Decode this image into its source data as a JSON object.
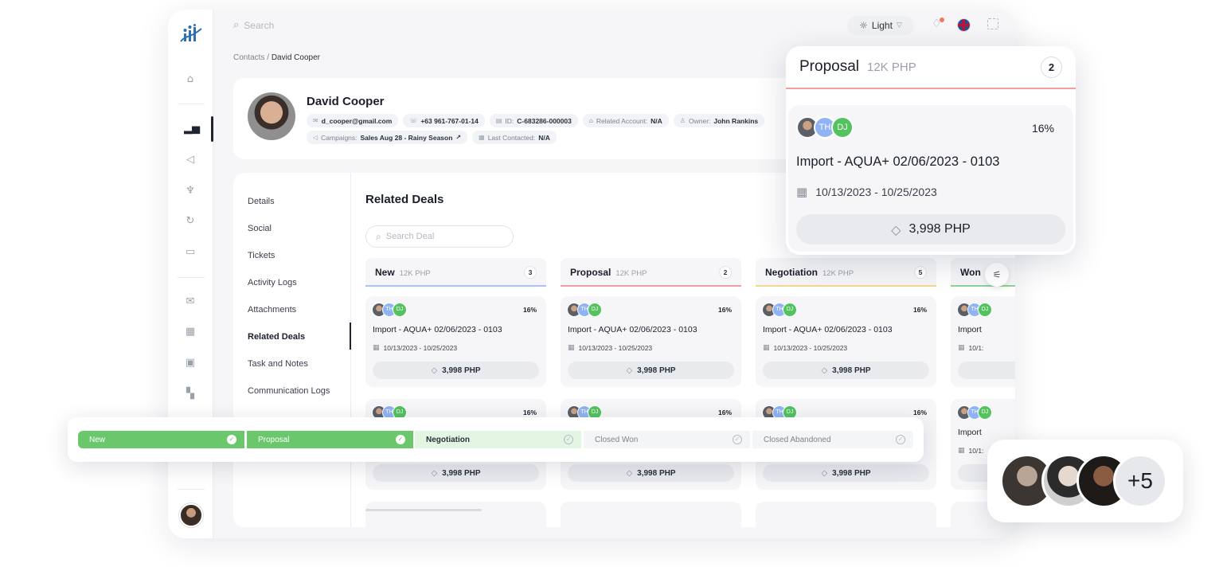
{
  "topbar": {
    "search_placeholder": "Search",
    "theme_label": "Light"
  },
  "breadcrumb": {
    "parent": "Contacts",
    "separator": "/",
    "current": "David Cooper"
  },
  "contact": {
    "name": "David Cooper",
    "email": "d_cooper@gmail.com",
    "phone": "+63 961-767-01-14",
    "id_label": "ID:",
    "id_value": "C-683286-000003",
    "related_account_label": "Related Account:",
    "related_account_value": "N/A",
    "owner_label": "Owner:",
    "owner_value": "John Rankins",
    "campaigns_label": "Campaigns:",
    "campaigns_value": "Sales Aug 28 - Rainy Season",
    "last_contacted_label": "Last Contacted:",
    "last_contacted_value": "N/A"
  },
  "tabs": [
    "Details",
    "Social",
    "Tickets",
    "Activity Logs",
    "Attachments",
    "Related Deals",
    "Task and Notes",
    "Communication Logs"
  ],
  "related_deals": {
    "title": "Related Deals",
    "search_placeholder": "Search Deal",
    "columns": [
      {
        "name": "New",
        "amount": "12K PHP",
        "count": "3",
        "color": "#a9c4ee"
      },
      {
        "name": "Proposal",
        "amount": "12K PHP",
        "count": "2",
        "color": "#f0a0a0"
      },
      {
        "name": "Negotiation",
        "amount": "12K PHP",
        "count": "5",
        "color": "#f2d88a"
      },
      {
        "name": "Won",
        "amount": "",
        "count": "",
        "color": "#8fd39a"
      }
    ],
    "deal": {
      "avatar_th": "TH",
      "avatar_dj": "DJ",
      "percent": "16%",
      "title": "Import - AQUA+ 02/06/2023 - 0103",
      "dates": "10/13/2023 - 10/25/2023",
      "price": "3,998 PHP"
    },
    "cropped": {
      "title": "Import",
      "dates": "10/1:"
    }
  },
  "stages": [
    {
      "label": "New",
      "state": "done"
    },
    {
      "label": "Proposal",
      "state": "done"
    },
    {
      "label": "Negotiation",
      "state": "current"
    },
    {
      "label": "Closed Won",
      "state": "todo"
    },
    {
      "label": "Closed Abandoned",
      "state": "todo"
    }
  ],
  "float_card": {
    "name": "Proposal",
    "amount": "12K PHP",
    "count": "2",
    "avatar_th": "TH",
    "avatar_dj": "DJ",
    "percent": "16%",
    "title": "Import - AQUA+ 02/06/2023 - 0103",
    "dates": "10/13/2023 - 10/25/2023",
    "price": "3,998 PHP"
  },
  "avatar_group": {
    "more": "+5"
  },
  "colors": {
    "accent_green": "#6bc76b",
    "current_stage": "#e3f5e3",
    "proposal_line": "#f0a0a0",
    "avatar_th": "#8fb3f3",
    "avatar_dj": "#53c25f"
  },
  "icons": {
    "sidebar": [
      "home-icon",
      "chart-icon",
      "megaphone-icon",
      "trophy-icon",
      "refresh-icon",
      "book-icon",
      "mail-icon",
      "calendar-icon",
      "chat-icon",
      "grid-icon"
    ]
  }
}
